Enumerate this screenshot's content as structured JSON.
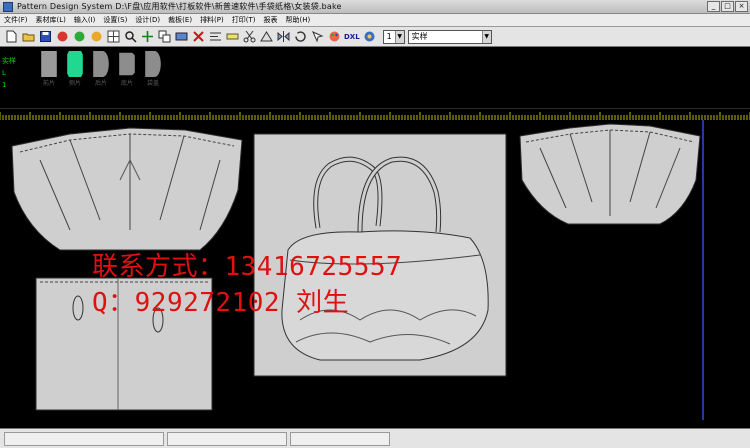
{
  "window": {
    "title": "Pattern Design System    D:\\F盘\\应用软件\\打板软件\\新普速软件\\手袋纸格\\女装袋.bake",
    "controls": [
      "_",
      "□",
      "×"
    ]
  },
  "menu": {
    "items": [
      "文件(F)",
      "素材库(L)",
      "输入(I)",
      "设置(S)",
      "设计(D)",
      "裁板(E)",
      "排料(P)",
      "打印(T)",
      "报表",
      "帮助(H)"
    ]
  },
  "toolbar": {
    "icons": [
      "new-file-icon",
      "open-folder-icon",
      "save-icon",
      "undo-icon",
      "redo-icon",
      "color-icon",
      "grid-icon",
      "zoom-icon",
      "move-icon",
      "copy-icon",
      "cut-icon",
      "delete-icon",
      "align-icon",
      "measure-icon",
      "scissors-icon",
      "notch-icon",
      "mirror-icon",
      "rotate-icon",
      "arrow-icon",
      "palette-icon",
      "cube-icon"
    ],
    "dxf_label": "DXL",
    "layer_value": "1",
    "style_value": "实样"
  },
  "pieces_panel": {
    "side_labels": [
      "实样",
      "L",
      "1"
    ],
    "pieces": [
      {
        "label": "前片",
        "color": "#9a9a9a"
      },
      {
        "label": "侧片",
        "color": "#20d890"
      },
      {
        "label": "后片",
        "color": "#8d8d8d"
      },
      {
        "label": "底片",
        "color": "#8d8d8d"
      },
      {
        "label": "袋盖",
        "color": "#8d8d8d"
      }
    ]
  },
  "watermark": {
    "line1": "联系方式：13416725557",
    "line2": "Q：929272102 刘生"
  },
  "colors": {
    "canvas_bg": "#000000",
    "piece_fill": "#cfcfcf",
    "piece_stroke": "#2f2f2f",
    "ruler": "#e6e600",
    "watermark": "#e01010",
    "boundary": "#2f4fd0"
  }
}
